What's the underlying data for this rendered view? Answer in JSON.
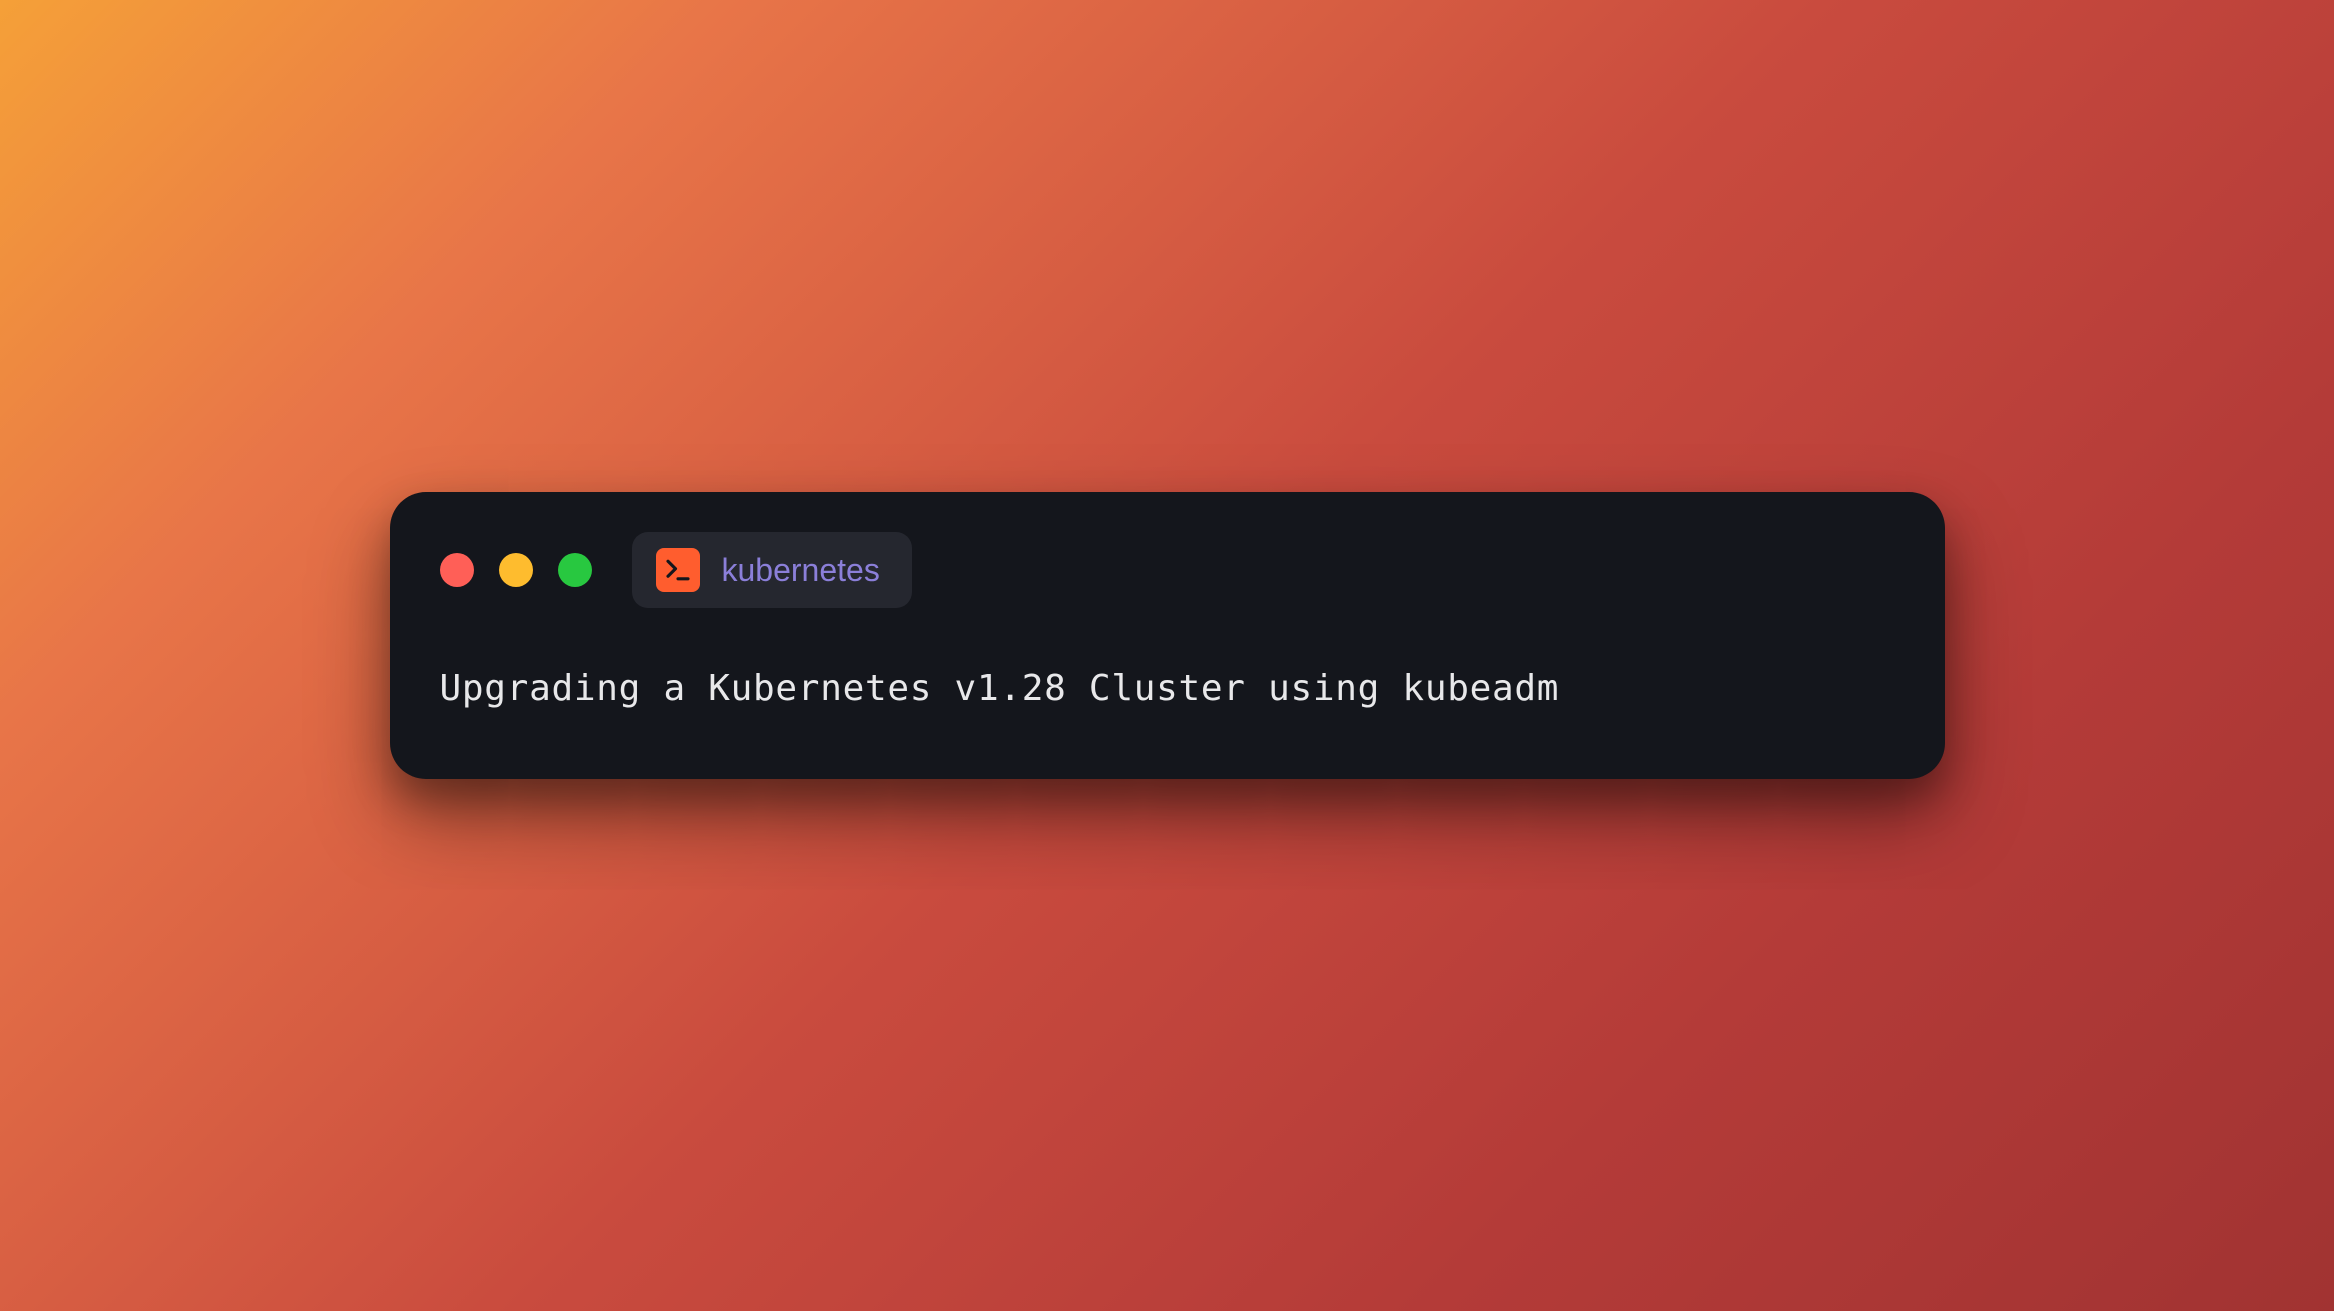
{
  "window": {
    "tab": {
      "label": "kubernetes",
      "icon": "terminal-icon"
    },
    "trafficLights": {
      "red": "#ff5f57",
      "yellow": "#febc2e",
      "green": "#28c840"
    }
  },
  "terminal": {
    "content": "Upgrading a Kubernetes v1.28 Cluster using kubeadm"
  },
  "colors": {
    "windowBg": "#14161c",
    "tabBg": "#25272f",
    "tabText": "#8b7fd9",
    "terminalText": "#e8e8ea",
    "iconBg": "#ff5d2e"
  }
}
